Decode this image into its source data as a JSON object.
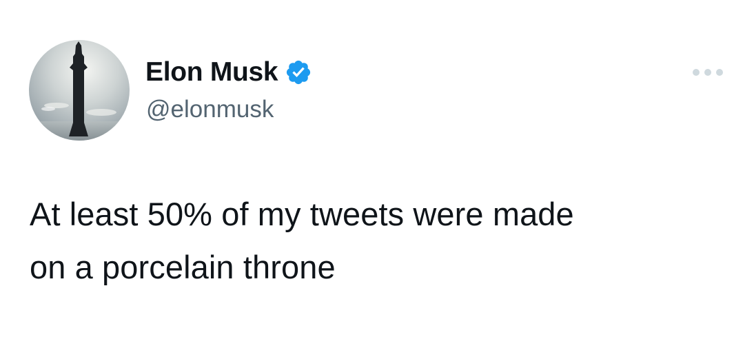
{
  "author": {
    "display_name": "Elon Musk",
    "handle": "@elonmusk",
    "verified": true,
    "verified_badge_color": "#1d9bf0",
    "avatar_icon": "starship-rocket-avatar"
  },
  "tweet": {
    "text": "At least 50% of my tweets were made\non a porcelain throne"
  },
  "actions": {
    "more_icon": "more-options-icon"
  },
  "colors": {
    "text_primary": "#0f1419",
    "text_secondary": "#536471",
    "background": "#ffffff",
    "more_dots": "#cfd9de"
  }
}
